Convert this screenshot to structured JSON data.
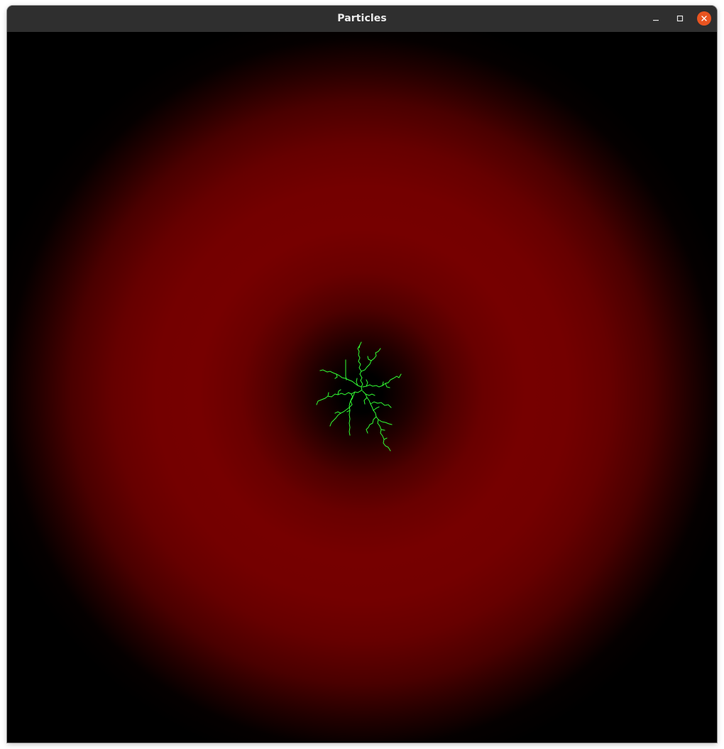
{
  "window": {
    "title": "Particles",
    "controls": {
      "minimize_icon": "minimize-icon",
      "maximize_icon": "maximize-icon",
      "close_icon": "close-icon"
    }
  },
  "simulation": {
    "background_color": "#000000",
    "field_color": "#760000",
    "cluster_color": "#33ff33"
  }
}
